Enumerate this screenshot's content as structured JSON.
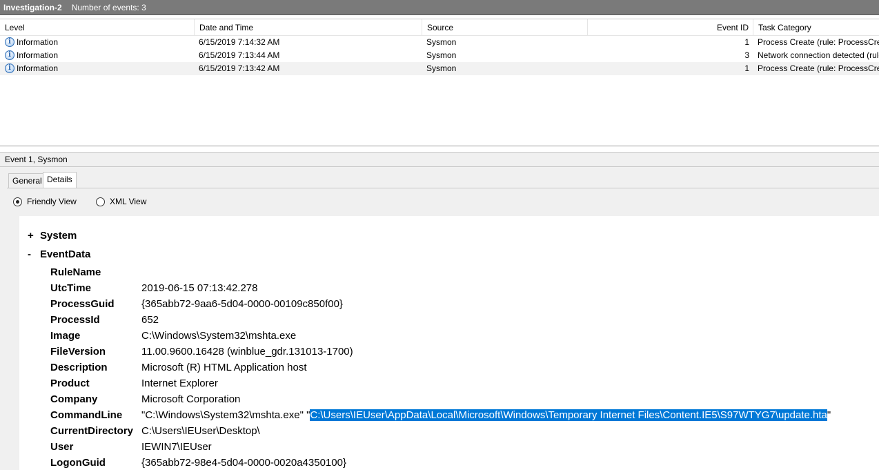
{
  "window": {
    "title": "Investigation-2",
    "event_count": "Number of events: 3"
  },
  "grid": {
    "columns": [
      "Level",
      "Date and Time",
      "Source",
      "Event ID",
      "Task Category"
    ],
    "rows": [
      {
        "level": "Information",
        "datetime": "6/15/2019 7:14:32 AM",
        "source": "Sysmon",
        "event_id": "1",
        "task": "Process Create (rule: ProcessCreate)"
      },
      {
        "level": "Information",
        "datetime": "6/15/2019 7:13:44 AM",
        "source": "Sysmon",
        "event_id": "3",
        "task": "Network connection detected (rule: NetworkConnect)"
      },
      {
        "level": "Information",
        "datetime": "6/15/2019 7:13:42 AM",
        "source": "Sysmon",
        "event_id": "1",
        "task": "Process Create (rule: ProcessCreate)"
      }
    ],
    "level_icon": "information-icon"
  },
  "detail": {
    "header": "Event 1, Sysmon",
    "tabs": [
      "General",
      "Details"
    ],
    "active_tab": "Details",
    "views": {
      "friendly": "Friendly View",
      "xml": "XML View",
      "selected": "Friendly View"
    }
  },
  "tree": {
    "system": {
      "toggle": "+",
      "label": "System"
    },
    "eventdata": {
      "toggle": "-",
      "label": "EventData"
    },
    "fields": [
      {
        "name": "RuleName",
        "value": ""
      },
      {
        "name": "UtcTime",
        "value": "2019-06-15 07:13:42.278"
      },
      {
        "name": "ProcessGuid",
        "value": "{365abb72-9aa6-5d04-0000-00109c850f00}"
      },
      {
        "name": "ProcessId",
        "value": "652"
      },
      {
        "name": "Image",
        "value": "C:\\Windows\\System32\\mshta.exe"
      },
      {
        "name": "FileVersion",
        "value": "11.00.9600.16428 (winblue_gdr.131013-1700)"
      },
      {
        "name": "Description",
        "value": "Microsoft (R) HTML Application host"
      },
      {
        "name": "Product",
        "value": "Internet Explorer"
      },
      {
        "name": "Company",
        "value": "Microsoft Corporation"
      },
      {
        "name": "CommandLine",
        "value_prefix": "\"C:\\Windows\\System32\\mshta.exe\" \"",
        "value_selected": "C:\\Users\\IEUser\\AppData\\Local\\Microsoft\\Windows\\Temporary Internet Files\\Content.IE5\\S97WTYG7\\update.hta",
        "value_suffix": "\""
      },
      {
        "name": "CurrentDirectory",
        "value": "C:\\Users\\IEUser\\Desktop\\"
      },
      {
        "name": "User",
        "value": "IEWIN7\\IEUser"
      },
      {
        "name": "LogonGuid",
        "value": "{365abb72-98e4-5d04-0000-0020a4350100}"
      }
    ]
  },
  "colors": {
    "selection": "#0078d7",
    "titlebar": "#7a7a7a",
    "info_icon": "#2f6fb8"
  }
}
